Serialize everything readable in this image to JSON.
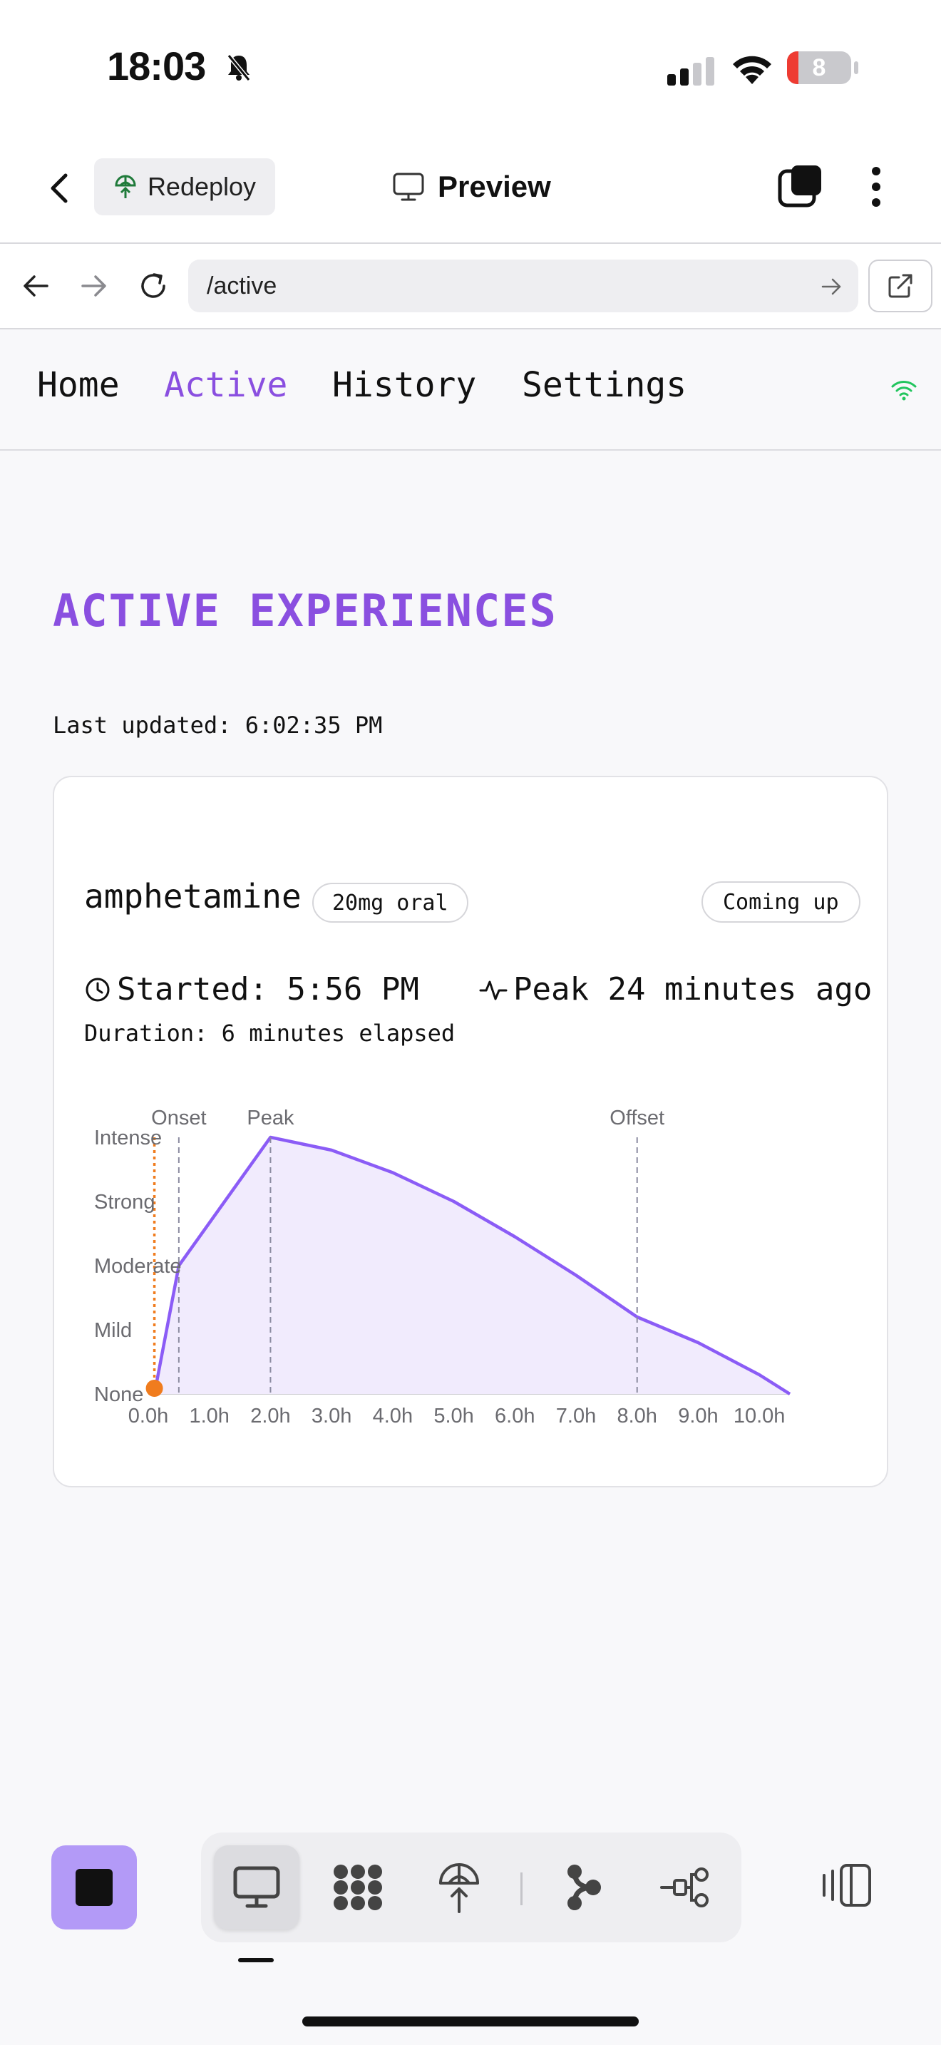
{
  "status_bar": {
    "time": "18:03",
    "battery": "8"
  },
  "header": {
    "redeploy_label": "Redeploy",
    "preview_label": "Preview"
  },
  "url_bar": {
    "value": "/active"
  },
  "nav": {
    "items": [
      "Home",
      "Active",
      "History",
      "Settings"
    ],
    "active": "Active"
  },
  "page": {
    "title": "ACTIVE EXPERIENCES",
    "last_updated": "Last updated: 6:02:35 PM"
  },
  "experience": {
    "substance": "amphetamine",
    "dose": "20mg oral",
    "phase": "Coming up",
    "started": "Started: 5:56 PM",
    "peak": "Peak 24 minutes ago",
    "duration": "Duration: 6 minutes elapsed"
  },
  "colors": {
    "accent": "#8a4fe0",
    "curve": "#8b5cf6",
    "curve_fill": "#f1ebfd",
    "now_marker": "#f07c1e",
    "signal": "#22c55e",
    "stop_button": "#b39af7"
  },
  "chart_data": {
    "type": "area",
    "x_ticks": [
      "0.0h",
      "1.0h",
      "2.0h",
      "3.0h",
      "4.0h",
      "5.0h",
      "6.0h",
      "7.0h",
      "8.0h",
      "9.0h",
      "10.0h"
    ],
    "y_ticks": [
      "None",
      "Mild",
      "Moderate",
      "Strong",
      "Intense"
    ],
    "xlim": [
      0,
      10.5
    ],
    "ylim": [
      0,
      4
    ],
    "curve": [
      [
        0.1,
        0
      ],
      [
        0.5,
        2
      ],
      [
        2.0,
        4
      ],
      [
        3.0,
        3.8
      ],
      [
        4.0,
        3.45
      ],
      [
        5.0,
        3.0
      ],
      [
        6.0,
        2.45
      ],
      [
        7.0,
        1.85
      ],
      [
        8.0,
        1.2
      ],
      [
        9.0,
        0.8
      ],
      [
        10.0,
        0.3
      ],
      [
        10.5,
        0
      ]
    ],
    "phase_markers": [
      {
        "label": "Onset",
        "x": 0.5
      },
      {
        "label": "Peak",
        "x": 2.0
      },
      {
        "label": "Offset",
        "x": 8.0
      }
    ],
    "current_time_x": 0.1
  }
}
